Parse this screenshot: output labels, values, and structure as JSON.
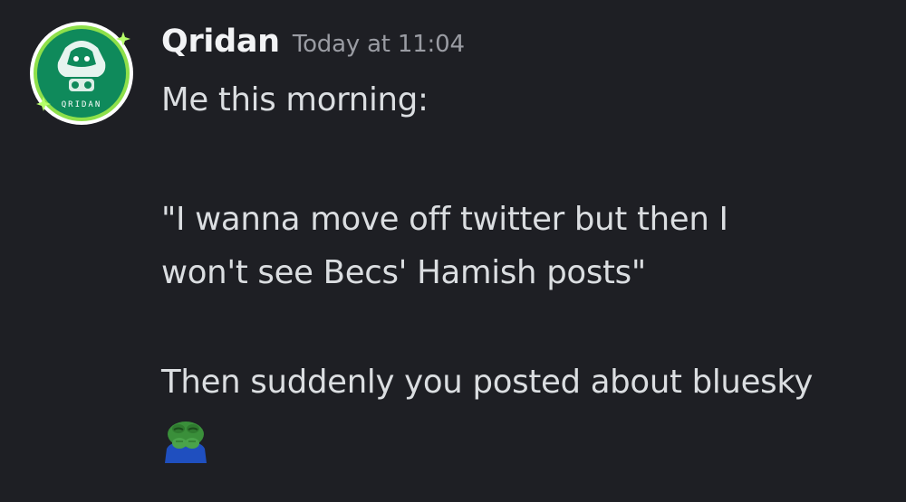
{
  "message": {
    "username": "Qridan",
    "timestamp": "Today at 11:04",
    "lines": [
      "Me this morning:",
      "\"I wanna move off twitter but then I",
      "won't see Becs' Hamish posts\"",
      "Then suddenly you posted about bluesky"
    ],
    "avatar": {
      "icon": "avatar-logo-icon",
      "text": "QRIDAN",
      "ring_color": "#8ee04a",
      "fill_color": "#0f8a5b"
    },
    "emoji": {
      "icon": "peepo-shy-emoji-icon",
      "colors": {
        "skin": "#3a8f3a",
        "shirt": "#1f4fbf"
      }
    }
  },
  "colors": {
    "background": "#1e1f24",
    "username": "#f2f3f5",
    "timestamp": "#9a9ca3",
    "text": "#dbdee1"
  }
}
